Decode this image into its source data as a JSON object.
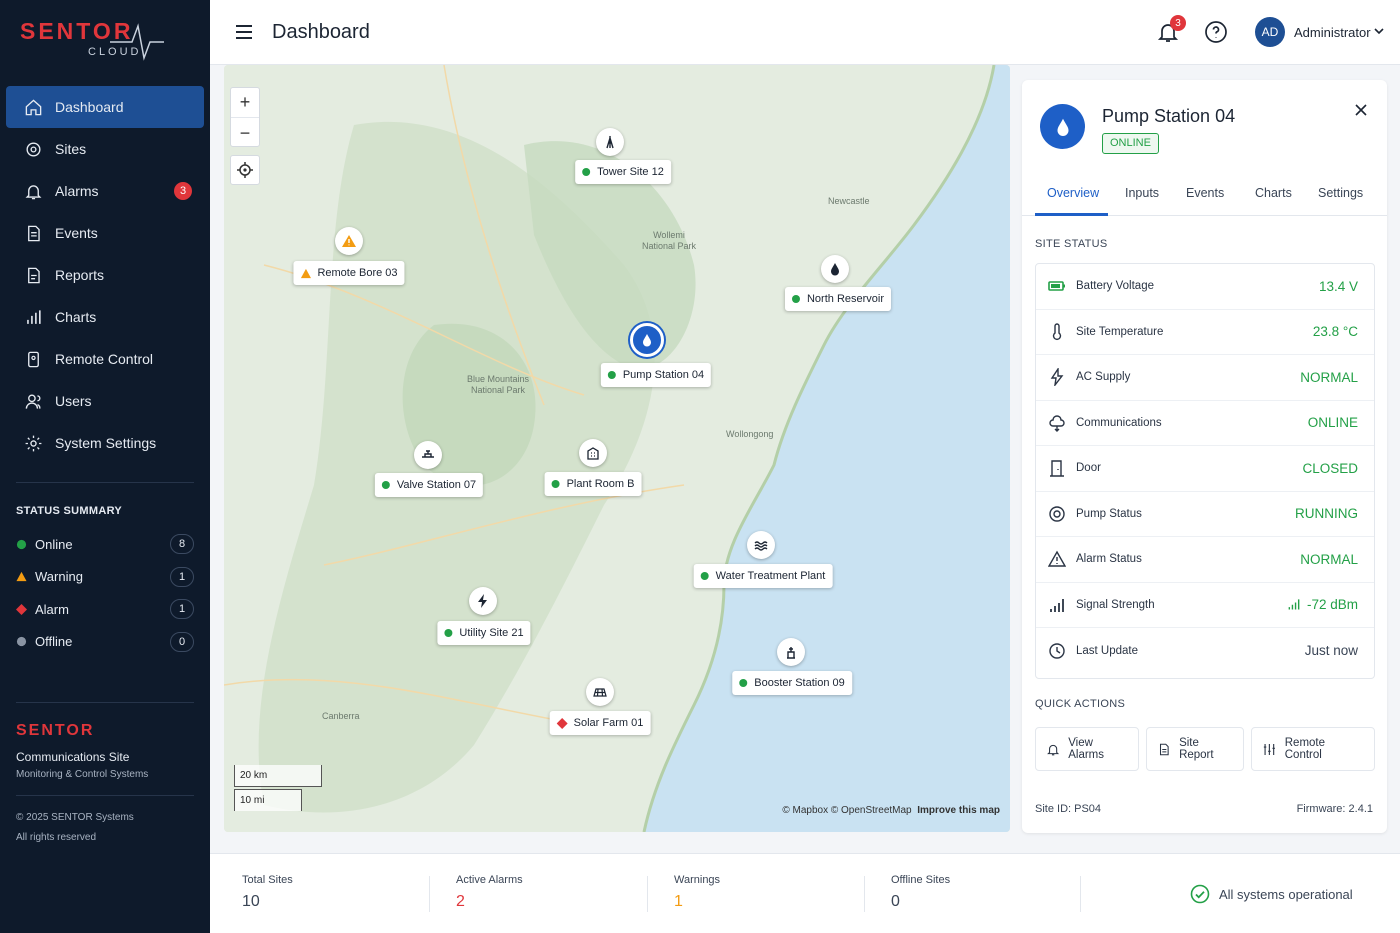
{
  "brand": {
    "name": "SENTOR",
    "sub": "CLOUD"
  },
  "nav": [
    {
      "label": "Dashboard",
      "icon": "home-icon",
      "active": true
    },
    {
      "label": "Sites",
      "icon": "target-icon"
    },
    {
      "label": "Alarms",
      "icon": "bell-icon",
      "badge": "3"
    },
    {
      "label": "Events",
      "icon": "document-icon"
    },
    {
      "label": "Reports",
      "icon": "report-icon"
    },
    {
      "label": "Charts",
      "icon": "bar-chart-icon"
    },
    {
      "label": "Remote Control",
      "icon": "remote-icon"
    },
    {
      "label": "Users",
      "icon": "user-icon"
    },
    {
      "label": "System Settings",
      "icon": "gear-icon"
    }
  ],
  "status_summary": {
    "title": "STATUS SUMMARY",
    "items": [
      {
        "label": "Online",
        "count": "8",
        "color": "#23a047"
      },
      {
        "label": "Warning",
        "count": "1",
        "color": "#f39c12"
      },
      {
        "label": "Alarm",
        "count": "1",
        "color": "#e0363b"
      },
      {
        "label": "Offline",
        "count": "0",
        "color": "#8a94a3"
      }
    ]
  },
  "footer_brand": {
    "name": "SENTOR",
    "line1": "Communications Site",
    "line2": "Monitoring & Control Systems"
  },
  "copyright": {
    "line1": "© 2025 SENTOR Systems",
    "line2": "All rights reserved"
  },
  "topbar": {
    "title": "Dashboard",
    "notif_count": "3",
    "avatar": "AD",
    "user": "Administrator"
  },
  "map": {
    "zoom_in": "+",
    "zoom_out": "−",
    "places": [
      {
        "name": "Newcastle"
      },
      {
        "name": "Wollemi\nNational Park"
      },
      {
        "name": "Blue Mountains\nNational Park"
      },
      {
        "name": "Wollongong"
      },
      {
        "name": "Canberra"
      }
    ],
    "sites": [
      {
        "name": "Tower Site 12",
        "status": "online",
        "icon": "tower-icon"
      },
      {
        "name": "Remote Bore 03",
        "status": "warning",
        "icon": "warning-icon"
      },
      {
        "name": "North Reservoir",
        "status": "online",
        "icon": "water-drop-icon"
      },
      {
        "name": "Pump Station 04",
        "status": "online",
        "icon": "water-drop-icon",
        "selected": true
      },
      {
        "name": "Valve Station 07",
        "status": "online",
        "icon": "valve-icon"
      },
      {
        "name": "Plant Room B",
        "status": "online",
        "icon": "building-icon"
      },
      {
        "name": "Water Treatment Plant",
        "status": "online",
        "icon": "waves-icon"
      },
      {
        "name": "Utility Site 21",
        "status": "online",
        "icon": "lightning-icon"
      },
      {
        "name": "Booster Station 09",
        "status": "online",
        "icon": "booster-icon"
      },
      {
        "name": "Solar Farm 01",
        "status": "alarm",
        "icon": "solar-icon"
      }
    ],
    "scale_km": "20 km",
    "scale_mi": "10 mi",
    "attribution": "© Mapbox © OpenStreetMap",
    "improve": "Improve this map"
  },
  "panel": {
    "title": "Pump Station 04",
    "status": "ONLINE",
    "tabs": [
      "Overview",
      "Inputs",
      "Events",
      "Charts",
      "Settings"
    ],
    "site_status_title": "SITE STATUS",
    "rows": [
      {
        "label": "Battery Voltage",
        "value": "13.4 V",
        "icon": "battery-icon"
      },
      {
        "label": "Site Temperature",
        "value": "23.8 °C",
        "icon": "thermometer-icon"
      },
      {
        "label": "AC Supply",
        "value": "NORMAL",
        "icon": "lightning-icon"
      },
      {
        "label": "Communications",
        "value": "ONLINE",
        "icon": "cloud-icon"
      },
      {
        "label": "Door",
        "value": "CLOSED",
        "icon": "door-icon"
      },
      {
        "label": "Pump Status",
        "value": "RUNNING",
        "icon": "pump-icon"
      },
      {
        "label": "Alarm Status",
        "value": "NORMAL",
        "icon": "warning-icon"
      },
      {
        "label": "Signal Strength",
        "value": "-72 dBm",
        "icon": "signal-icon"
      },
      {
        "label": "Last Update",
        "value": "Just now",
        "icon": "clock-icon"
      }
    ],
    "quick_actions_title": "QUICK ACTIONS",
    "actions": [
      {
        "label": "View Alarms",
        "icon": "bell-icon"
      },
      {
        "label": "Site Report",
        "icon": "document-icon"
      },
      {
        "label": "Remote Control",
        "icon": "sliders-icon"
      }
    ],
    "site_id": "Site ID: PS04",
    "firmware": "Firmware: 2.4.1"
  },
  "bottom": {
    "stats": [
      {
        "label": "Total Sites",
        "value": "10",
        "color": "#3a4556"
      },
      {
        "label": "Active Alarms",
        "value": "2",
        "color": "#e0363b"
      },
      {
        "label": "Warnings",
        "value": "1",
        "color": "#f39c12"
      },
      {
        "label": "Offline Sites",
        "value": "0",
        "color": "#3a4556"
      }
    ],
    "all_ok": "All systems operational"
  }
}
